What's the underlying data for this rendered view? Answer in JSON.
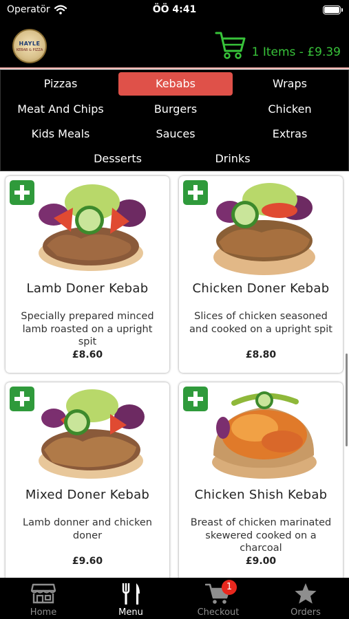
{
  "status_bar": {
    "carrier": "Operatör",
    "time": "ÖÖ 4:41"
  },
  "header": {
    "logo_text": "HAYLE",
    "logo_subtext": "KEBAB & PIZZA",
    "cart_summary": "1 Items - £9.39",
    "accent_color": "#38c33a"
  },
  "categories": [
    {
      "label": "Pizzas",
      "active": false
    },
    {
      "label": "Kebabs",
      "active": true
    },
    {
      "label": "Wraps",
      "active": false
    },
    {
      "label": "Meat And Chips",
      "active": false
    },
    {
      "label": "Burgers",
      "active": false
    },
    {
      "label": "Chicken",
      "active": false
    },
    {
      "label": "Kids Meals",
      "active": false
    },
    {
      "label": "Sauces",
      "active": false
    },
    {
      "label": "Extras",
      "active": false
    },
    {
      "label": "Desserts",
      "active": false
    },
    {
      "label": "Drinks",
      "active": false
    }
  ],
  "products": [
    {
      "name": "Lamb Doner Kebab",
      "desc": "Specially prepared minced lamb roasted on a upright spit",
      "price": "£8.60"
    },
    {
      "name": "Chicken Doner Kebab",
      "desc": "Slices of chicken seasoned and cooked on a upright spit",
      "price": "£8.80"
    },
    {
      "name": "Mixed Doner Kebab",
      "desc": "Lamb donner and chicken doner",
      "price": "£9.60"
    },
    {
      "name": "Chicken Shish Kebab",
      "desc": "Breast of chicken marinated skewered cooked on a charcoal",
      "price": "£9.00"
    }
  ],
  "tabbar": {
    "home": "Home",
    "menu": "Menu",
    "checkout": "Checkout",
    "checkout_badge": "1",
    "orders": "Orders",
    "active_tab": "menu"
  },
  "colors": {
    "active_category": "#df5149",
    "add_button": "#2f9a3b",
    "badge": "#e8281e"
  }
}
